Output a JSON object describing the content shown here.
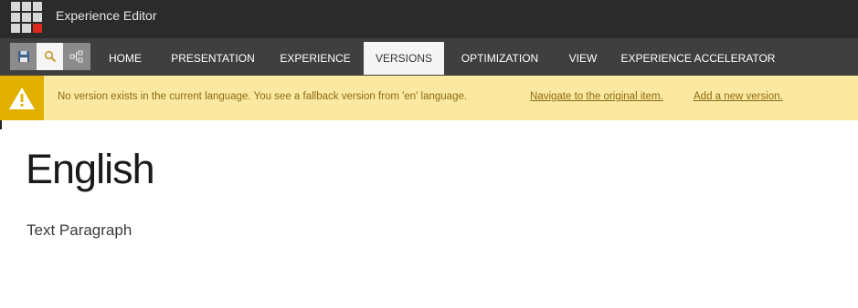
{
  "app": {
    "title": "Experience Editor"
  },
  "colors": {
    "topbar": "#2b2b2b",
    "ribbon": "#3f3f3f",
    "active_tab": "#f5f5f5",
    "notice_bg": "#fce9a1",
    "notice_icon_bg": "#e2b100",
    "logo_accent": "#dc291e"
  },
  "quick_access": [
    {
      "icon": "save-icon"
    },
    {
      "icon": "search-icon"
    },
    {
      "icon": "navigation-tree-icon"
    }
  ],
  "tabs": [
    {
      "label": "HOME",
      "active": false
    },
    {
      "label": "PRESENTATION",
      "active": false
    },
    {
      "label": "EXPERIENCE",
      "active": false
    },
    {
      "label": "VERSIONS",
      "active": true
    },
    {
      "label": "OPTIMIZATION",
      "active": false
    },
    {
      "label": "VIEW",
      "active": false
    },
    {
      "label": "EXPERIENCE ACCELERATOR",
      "active": false
    }
  ],
  "notice": {
    "icon": "warning-icon",
    "message": "No version exists in the current language. You see a fallback version from 'en' language.",
    "link_original": "Navigate to the original item.",
    "link_add": "Add a new version."
  },
  "content": {
    "heading": "English",
    "paragraph": "Text Paragraph"
  }
}
